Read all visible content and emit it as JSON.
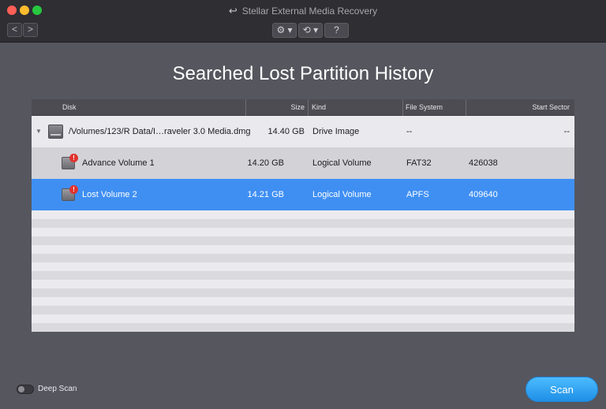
{
  "window": {
    "title": "Stellar External Media Recovery",
    "back_icon": "back-arrow-icon",
    "nav_back": "<",
    "nav_forward": ">",
    "toolbar": {
      "settings_icon": "⚙ ▾",
      "history_icon": "⟲ ▾",
      "help_icon": "?"
    }
  },
  "heading": "Searched Lost Partition History",
  "table": {
    "columns": [
      "Disk",
      "Size",
      "Kind",
      "File System",
      "Start Sector"
    ],
    "rows": [
      {
        "disk": "/Volumes/123/R Data/I…raveler 3.0 Media.dmg",
        "size": "14.40 GB",
        "kind": "Drive Image",
        "fs": "--",
        "sector": "--"
      },
      {
        "disk": "Advance Volume 1",
        "size": "14.20 GB",
        "kind": "Logical Volume",
        "fs": "FAT32",
        "sector": "426038"
      },
      {
        "disk": "Lost Volume 2",
        "size": "14.21 GB",
        "kind": "Logical Volume",
        "fs": "APFS",
        "sector": "409640"
      }
    ],
    "selected_row": 2,
    "warning_badge": "!"
  },
  "footer": {
    "deep_scan_label": "Deep Scan",
    "deep_scan_on": false,
    "scan_button": "Scan"
  },
  "colors": {
    "selection": "#3f8ff3",
    "scan_button": "#2a9df0",
    "background": "#56565f"
  }
}
